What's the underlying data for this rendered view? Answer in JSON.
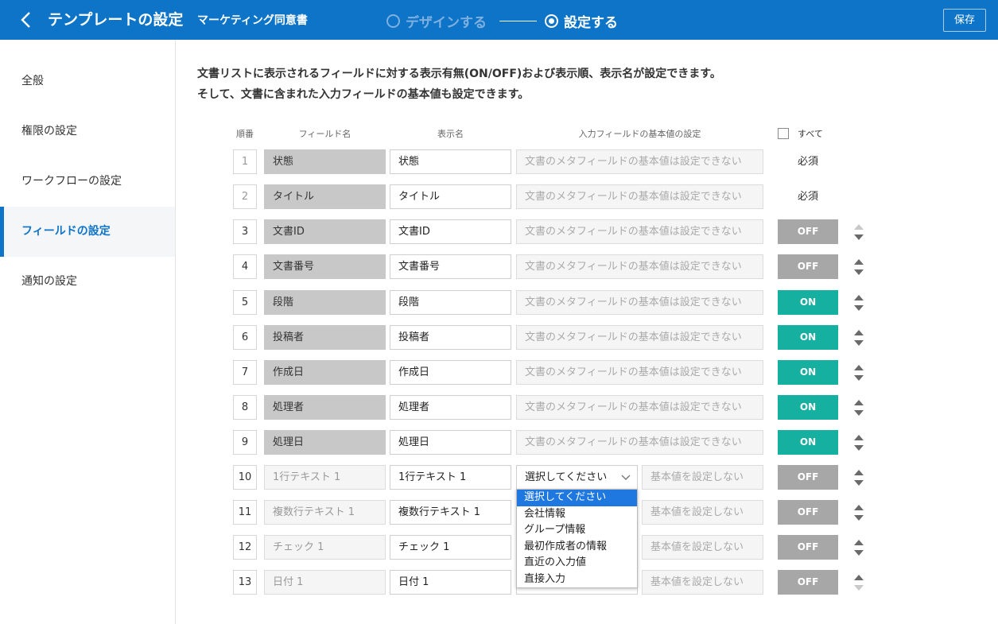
{
  "header": {
    "title": "テンプレートの設定",
    "subtitle": "マーケティング同意書",
    "step1": "デザインする",
    "step2": "設定する",
    "save_label": "保存"
  },
  "sidebar": {
    "items": [
      {
        "label": "全般",
        "active": false
      },
      {
        "label": "権限の設定",
        "active": false
      },
      {
        "label": "ワークフローの設定",
        "active": false
      },
      {
        "label": "フィールドの設定",
        "active": true
      },
      {
        "label": "通知の設定",
        "active": false
      }
    ]
  },
  "main": {
    "desc_line1": "文書リストに表示されるフィールドに対する表示有無(ON/OFF)および表示順、表示名が設定できます。",
    "desc_line2": "そして、文書に含まれた入力フィールドの基本値も設定できます。",
    "columns": {
      "order": "順番",
      "field": "フィールド名",
      "display": "表示名",
      "default": "入力フィールドの基本値の設定",
      "all": "すべて"
    },
    "meta_placeholder": "文書のメタフィールドの基本値は設定できない",
    "select_placeholder": "選択してください",
    "no_default": "基本値を設定しない",
    "rows": [
      {
        "no": "1",
        "field": "状態",
        "display": "状態",
        "status": "必須"
      },
      {
        "no": "2",
        "field": "タイトル",
        "display": "タイトル",
        "status": "必須"
      },
      {
        "no": "3",
        "field": "文書ID",
        "display": "文書ID",
        "status": "OFF"
      },
      {
        "no": "4",
        "field": "文書番号",
        "display": "文書番号",
        "status": "OFF"
      },
      {
        "no": "5",
        "field": "段階",
        "display": "段階",
        "status": "ON"
      },
      {
        "no": "6",
        "field": "投稿者",
        "display": "投稿者",
        "status": "ON"
      },
      {
        "no": "7",
        "field": "作成日",
        "display": "作成日",
        "status": "ON"
      },
      {
        "no": "8",
        "field": "処理者",
        "display": "処理者",
        "status": "ON"
      },
      {
        "no": "9",
        "field": "処理日",
        "display": "処理日",
        "status": "ON"
      },
      {
        "no": "10",
        "field": "1行テキスト 1",
        "display": "1行テキスト 1",
        "status": "OFF"
      },
      {
        "no": "11",
        "field": "複数行テキスト 1",
        "display": "複数行テキスト 1",
        "status": "OFF"
      },
      {
        "no": "12",
        "field": "チェック 1",
        "display": "チェック 1",
        "status": "OFF"
      },
      {
        "no": "13",
        "field": "日付 1",
        "display": "日付 1",
        "status": "OFF"
      }
    ],
    "dropdown_options": [
      "選択してください",
      "会社情報",
      "グループ情報",
      "最初作成者の情報",
      "直近の入力値",
      "直接入力"
    ]
  },
  "colors": {
    "primary": "#0d74c8",
    "on": "#15b0a0",
    "off": "#a7a7a7"
  }
}
